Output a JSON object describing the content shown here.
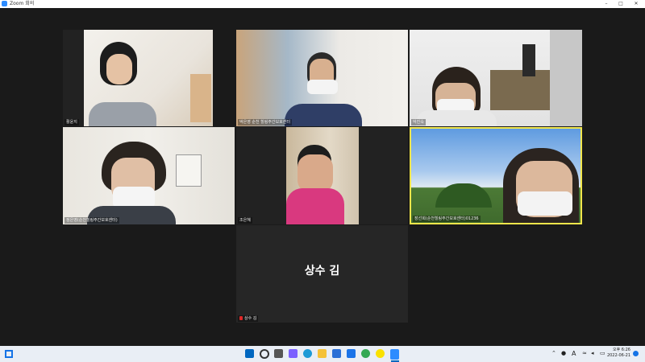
{
  "window": {
    "title": "Zoom 회의",
    "minimize": "–",
    "maximize": "□",
    "close": "✕"
  },
  "participants": [
    {
      "name": "활윤지"
    },
    {
      "name": "박은영 순천 힐링주간보호센터"
    },
    {
      "name": "박진숙"
    },
    {
      "name": "정은영(순천힐링주간보호센터)"
    },
    {
      "name": "조은혜"
    },
    {
      "name": "장선희(순천힐링주간보호센터)01236"
    },
    {
      "name": "상수 김",
      "display_name": "상수 김",
      "muted": true
    }
  ],
  "active_speaker_color": "#f2e64b",
  "taskbar": {
    "apps": [
      "start-icon",
      "search-icon",
      "task-view-icon",
      "widgets-icon",
      "chat-icon",
      "edge-icon",
      "file-explorer-icon",
      "store-icon",
      "mail-icon",
      "chrome-icon",
      "kakaotalk-icon",
      "zoom-icon"
    ],
    "ime": "A",
    "time": "오후 6:26",
    "date": "2022-06-21"
  }
}
